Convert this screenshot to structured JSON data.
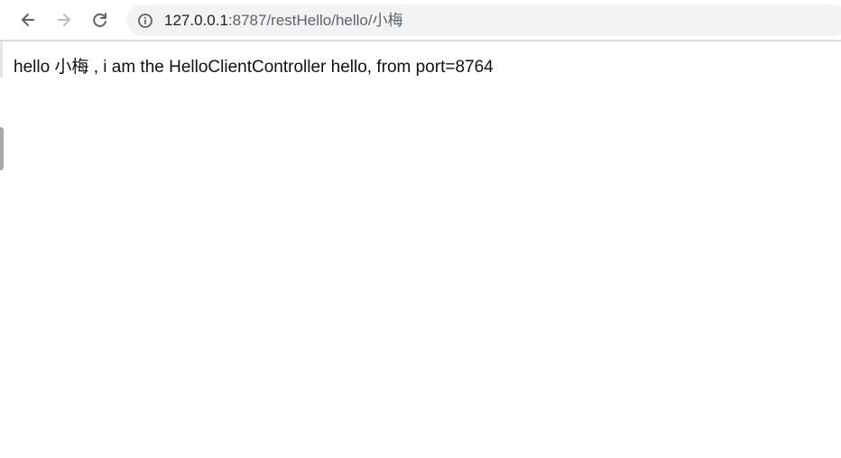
{
  "browser": {
    "icons": {
      "back": "arrow-left-icon",
      "forward": "arrow-right-icon",
      "reload": "reload-icon",
      "site_info": "info-circle-icon"
    },
    "address_bar": {
      "host": "127.0.0.1",
      "path": ":8787/restHello/hello/小梅"
    }
  },
  "page": {
    "body_text": "hello 小梅 , i am the HelloClientController hello, from port=8764"
  },
  "colors": {
    "omnibox_background": "#f1f3f4",
    "icon_active": "#5f6368",
    "icon_disabled": "#b9bcc0"
  }
}
